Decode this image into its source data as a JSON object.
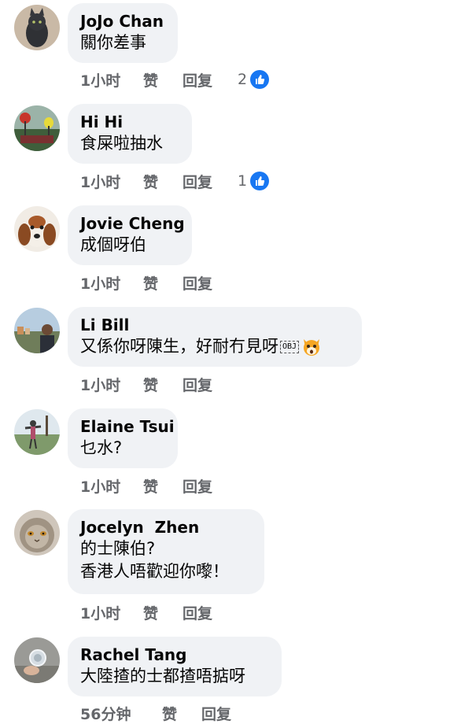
{
  "comments": [
    {
      "name": "JoJo Chan",
      "lines": [
        "關你差事"
      ],
      "time": "1小时",
      "like": "赞",
      "reply": "回复",
      "reaction_count": "2"
    },
    {
      "name": "Hi Hi",
      "lines": [
        "食屎啦抽水"
      ],
      "time": "1小时",
      "like": "赞",
      "reply": "回复",
      "reaction_count": "1"
    },
    {
      "name": "Jovie Cheng",
      "lines": [
        "成個呀伯"
      ],
      "time": "1小时",
      "like": "赞",
      "reply": "回复"
    },
    {
      "name": "Li Bill",
      "lines": [
        "又係你呀陳生，好耐冇見呀"
      ],
      "obj_glyph": "OBJ",
      "time": "1小时",
      "like": "赞",
      "reply": "回复"
    },
    {
      "name": "Elaine Tsui",
      "lines": [
        "乜水?"
      ],
      "time": "1小时",
      "like": "赞",
      "reply": "回复"
    },
    {
      "name": "Jocelyn  Zhen",
      "lines": [
        "的士陳伯?",
        "香港人唔歡迎你嚟！"
      ],
      "time": "1小时",
      "like": "赞",
      "reply": "回复"
    },
    {
      "name": "Rachel Tang",
      "lines": [
        "大陸揸的士都揸唔掂呀"
      ],
      "time": "56分钟",
      "like": "赞",
      "reply": "回复"
    }
  ],
  "icons": {
    "reaction": "thumbs-up-icon",
    "emoji": "shocked-fox-emoji-icon"
  },
  "colors": {
    "bubble": "#f0f2f5",
    "meta_text": "#65676b",
    "like_blue": "#1877f2"
  }
}
